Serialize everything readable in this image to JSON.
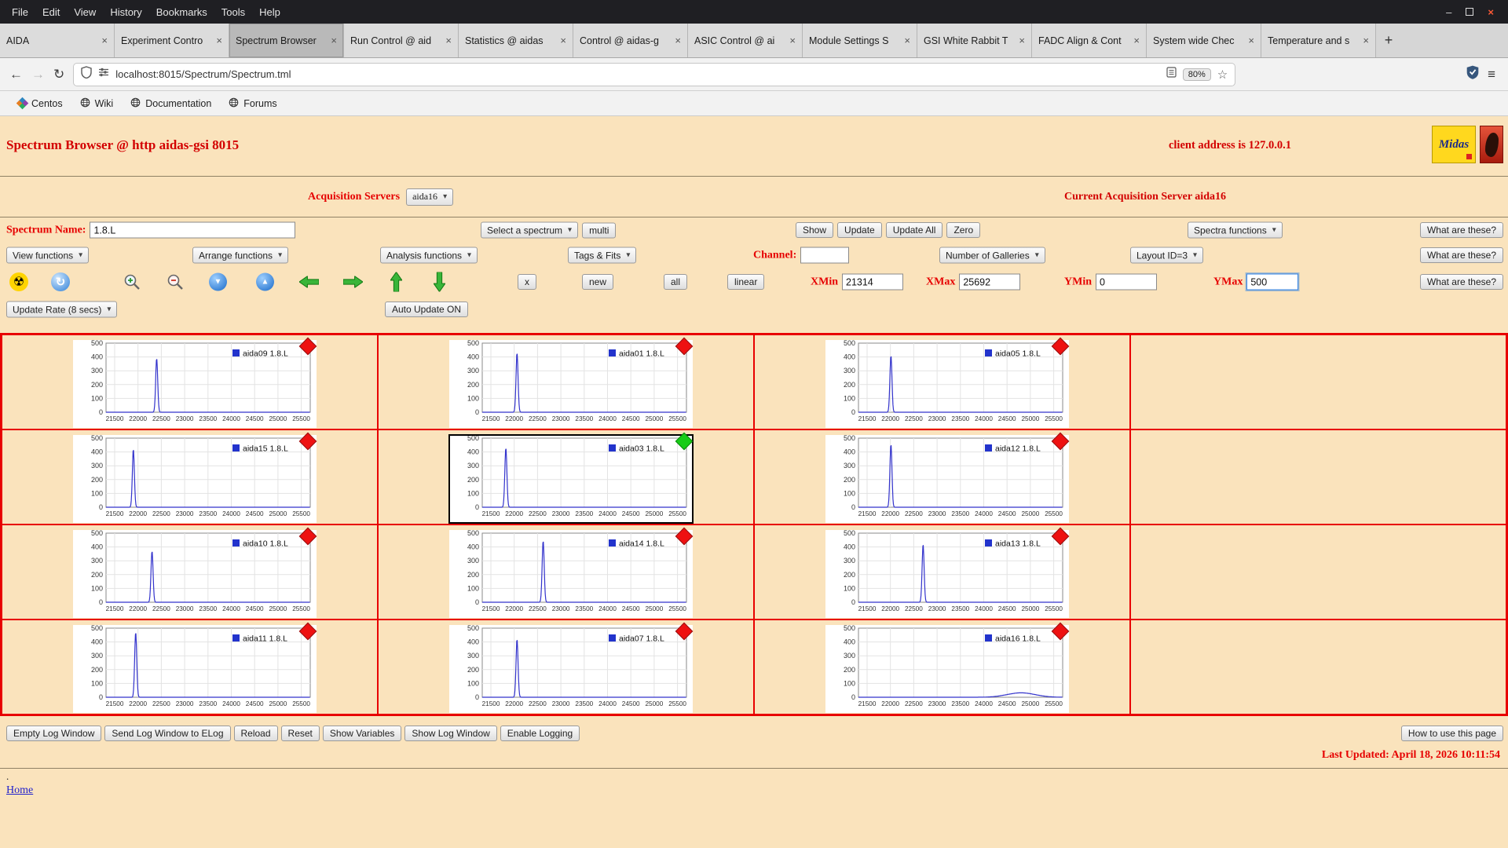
{
  "colors": {
    "page_bg": "#fae3bc",
    "accent_red": "#e60000",
    "grid_border": "#e80000",
    "line_color": "#3333cc",
    "marker_red": "#ee1111",
    "marker_green": "#18cc18"
  },
  "chrome": {
    "menu": [
      "File",
      "Edit",
      "View",
      "History",
      "Bookmarks",
      "Tools",
      "Help"
    ],
    "window_controls": {
      "minimize": "–",
      "close": "×"
    },
    "tabs": [
      {
        "label": "AIDA",
        "active": false
      },
      {
        "label": "Experiment Contro",
        "active": false
      },
      {
        "label": "Spectrum Browser",
        "active": true
      },
      {
        "label": "Run Control @ aid",
        "active": false
      },
      {
        "label": "Statistics @ aidas",
        "active": false
      },
      {
        "label": "Control @ aidas-g",
        "active": false
      },
      {
        "label": "ASIC Control @ ai",
        "active": false
      },
      {
        "label": "Module Settings S",
        "active": false
      },
      {
        "label": "GSI White Rabbit T",
        "active": false
      },
      {
        "label": "FADC Align & Cont",
        "active": false
      },
      {
        "label": "System wide Chec",
        "active": false
      },
      {
        "label": "Temperature and s",
        "active": false
      }
    ],
    "tab_close": "×",
    "new_tab_label": "+",
    "url": "localhost:8015/Spectrum/Spectrum.tml",
    "zoom": "80%",
    "bookmarks": [
      "Centos",
      "Wiki",
      "Documentation",
      "Forums"
    ]
  },
  "icons": {
    "radioactive": "☢",
    "refresh": "↻",
    "down_arrow": "▼",
    "up_arrow": "▲",
    "star": "☆",
    "menu": "≡",
    "back": "←",
    "forward": "→",
    "reload": "↻"
  },
  "header": {
    "title": "Spectrum Browser @ http aidas-gsi 8015",
    "client_address": "client address is 127.0.0.1",
    "logo_midas": "Midas"
  },
  "toolbar1": {
    "acq_label": "Acquisition Servers",
    "acq_value": "aida16",
    "current_server": "Current Acquisition Server aida16"
  },
  "toolbar2": {
    "spectrum_name_label": "Spectrum Name:",
    "spectrum_name_value": "1.8.L",
    "select_spectrum": "Select a spectrum",
    "multi": "multi",
    "show": "Show",
    "update": "Update",
    "update_all": "Update All",
    "zero": "Zero",
    "spectra_functions": "Spectra functions",
    "what": "What are these?"
  },
  "toolbar3": {
    "view_functions": "View functions",
    "arrange_functions": "Arrange functions",
    "analysis_functions": "Analysis functions",
    "tags_fits": "Tags & Fits",
    "channel_label": "Channel:",
    "channel_value": "",
    "num_galleries": "Number of Galleries",
    "layout_id": "Layout ID=3",
    "what": "What are these?"
  },
  "toolbar4": {
    "x": "x",
    "new": "new",
    "all": "all",
    "linear": "linear",
    "xmin_label": "XMin",
    "xmin": "21314",
    "xmax_label": "XMax",
    "xmax": "25692",
    "ymin_label": "YMin",
    "ymin": "0",
    "ymax_label": "YMax",
    "ymax": "500",
    "what": "What are these?"
  },
  "toolbar5": {
    "update_rate": "Update Rate (8 secs)",
    "auto_update": "Auto Update ON"
  },
  "footer": {
    "buttons": [
      "Empty Log Window",
      "Send Log Window to ELog",
      "Reload",
      "Reset",
      "Show Variables",
      "Show Log Window",
      "Enable Logging"
    ],
    "help_button": "How to use this page",
    "last_updated": "Last Updated: April 18, 2026 10:11:54",
    "dot": ".",
    "home": "Home"
  },
  "chart_data": {
    "type": "line",
    "x_range": [
      21314,
      25692
    ],
    "x_ticks": [
      21500,
      22000,
      22500,
      23000,
      23500,
      24000,
      24500,
      25000,
      25500
    ],
    "y_ticks": [
      0,
      100,
      200,
      300,
      400,
      500
    ],
    "ylim": [
      0,
      500
    ],
    "line_color": "#3333cc",
    "legend_square_color": "#2233cc",
    "rows": [
      [
        {
          "name": "aida09",
          "legend": "aida09 1.8.L",
          "peak_x": 22400,
          "peak_h": 390,
          "sigma": 22,
          "marker": "red"
        },
        {
          "name": "aida01",
          "legend": "aida01 1.8.L",
          "peak_x": 22060,
          "peak_h": 430,
          "sigma": 22,
          "marker": "red"
        },
        {
          "name": "aida05",
          "legend": "aida05 1.8.L",
          "peak_x": 22010,
          "peak_h": 410,
          "sigma": 22,
          "marker": "red"
        },
        null
      ],
      [
        {
          "name": "aida15",
          "legend": "aida15 1.8.L",
          "peak_x": 21900,
          "peak_h": 420,
          "sigma": 22,
          "marker": "red"
        },
        {
          "name": "aida03",
          "legend": "aida03 1.8.L",
          "peak_x": 21820,
          "peak_h": 430,
          "sigma": 22,
          "marker": "green",
          "selected": true
        },
        {
          "name": "aida12",
          "legend": "aida12 1.8.L",
          "peak_x": 22010,
          "peak_h": 455,
          "sigma": 22,
          "marker": "red"
        },
        null
      ],
      [
        {
          "name": "aida10",
          "legend": "aida10 1.8.L",
          "peak_x": 22300,
          "peak_h": 370,
          "sigma": 22,
          "marker": "red"
        },
        {
          "name": "aida14",
          "legend": "aida14 1.8.L",
          "peak_x": 22620,
          "peak_h": 445,
          "sigma": 22,
          "marker": "red"
        },
        {
          "name": "aida13",
          "legend": "aida13 1.8.L",
          "peak_x": 22700,
          "peak_h": 420,
          "sigma": 22,
          "marker": "red"
        },
        null
      ],
      [
        {
          "name": "aida11",
          "legend": "aida11 1.8.L",
          "peak_x": 21950,
          "peak_h": 470,
          "sigma": 22,
          "marker": "red"
        },
        {
          "name": "aida07",
          "legend": "aida07 1.8.L",
          "peak_x": 22060,
          "peak_h": 420,
          "sigma": 22,
          "marker": "red"
        },
        {
          "name": "aida16",
          "legend": "aida16 1.8.L",
          "peak_x": 24800,
          "peak_h": 32,
          "sigma": 300,
          "marker": "red"
        },
        null
      ]
    ]
  }
}
